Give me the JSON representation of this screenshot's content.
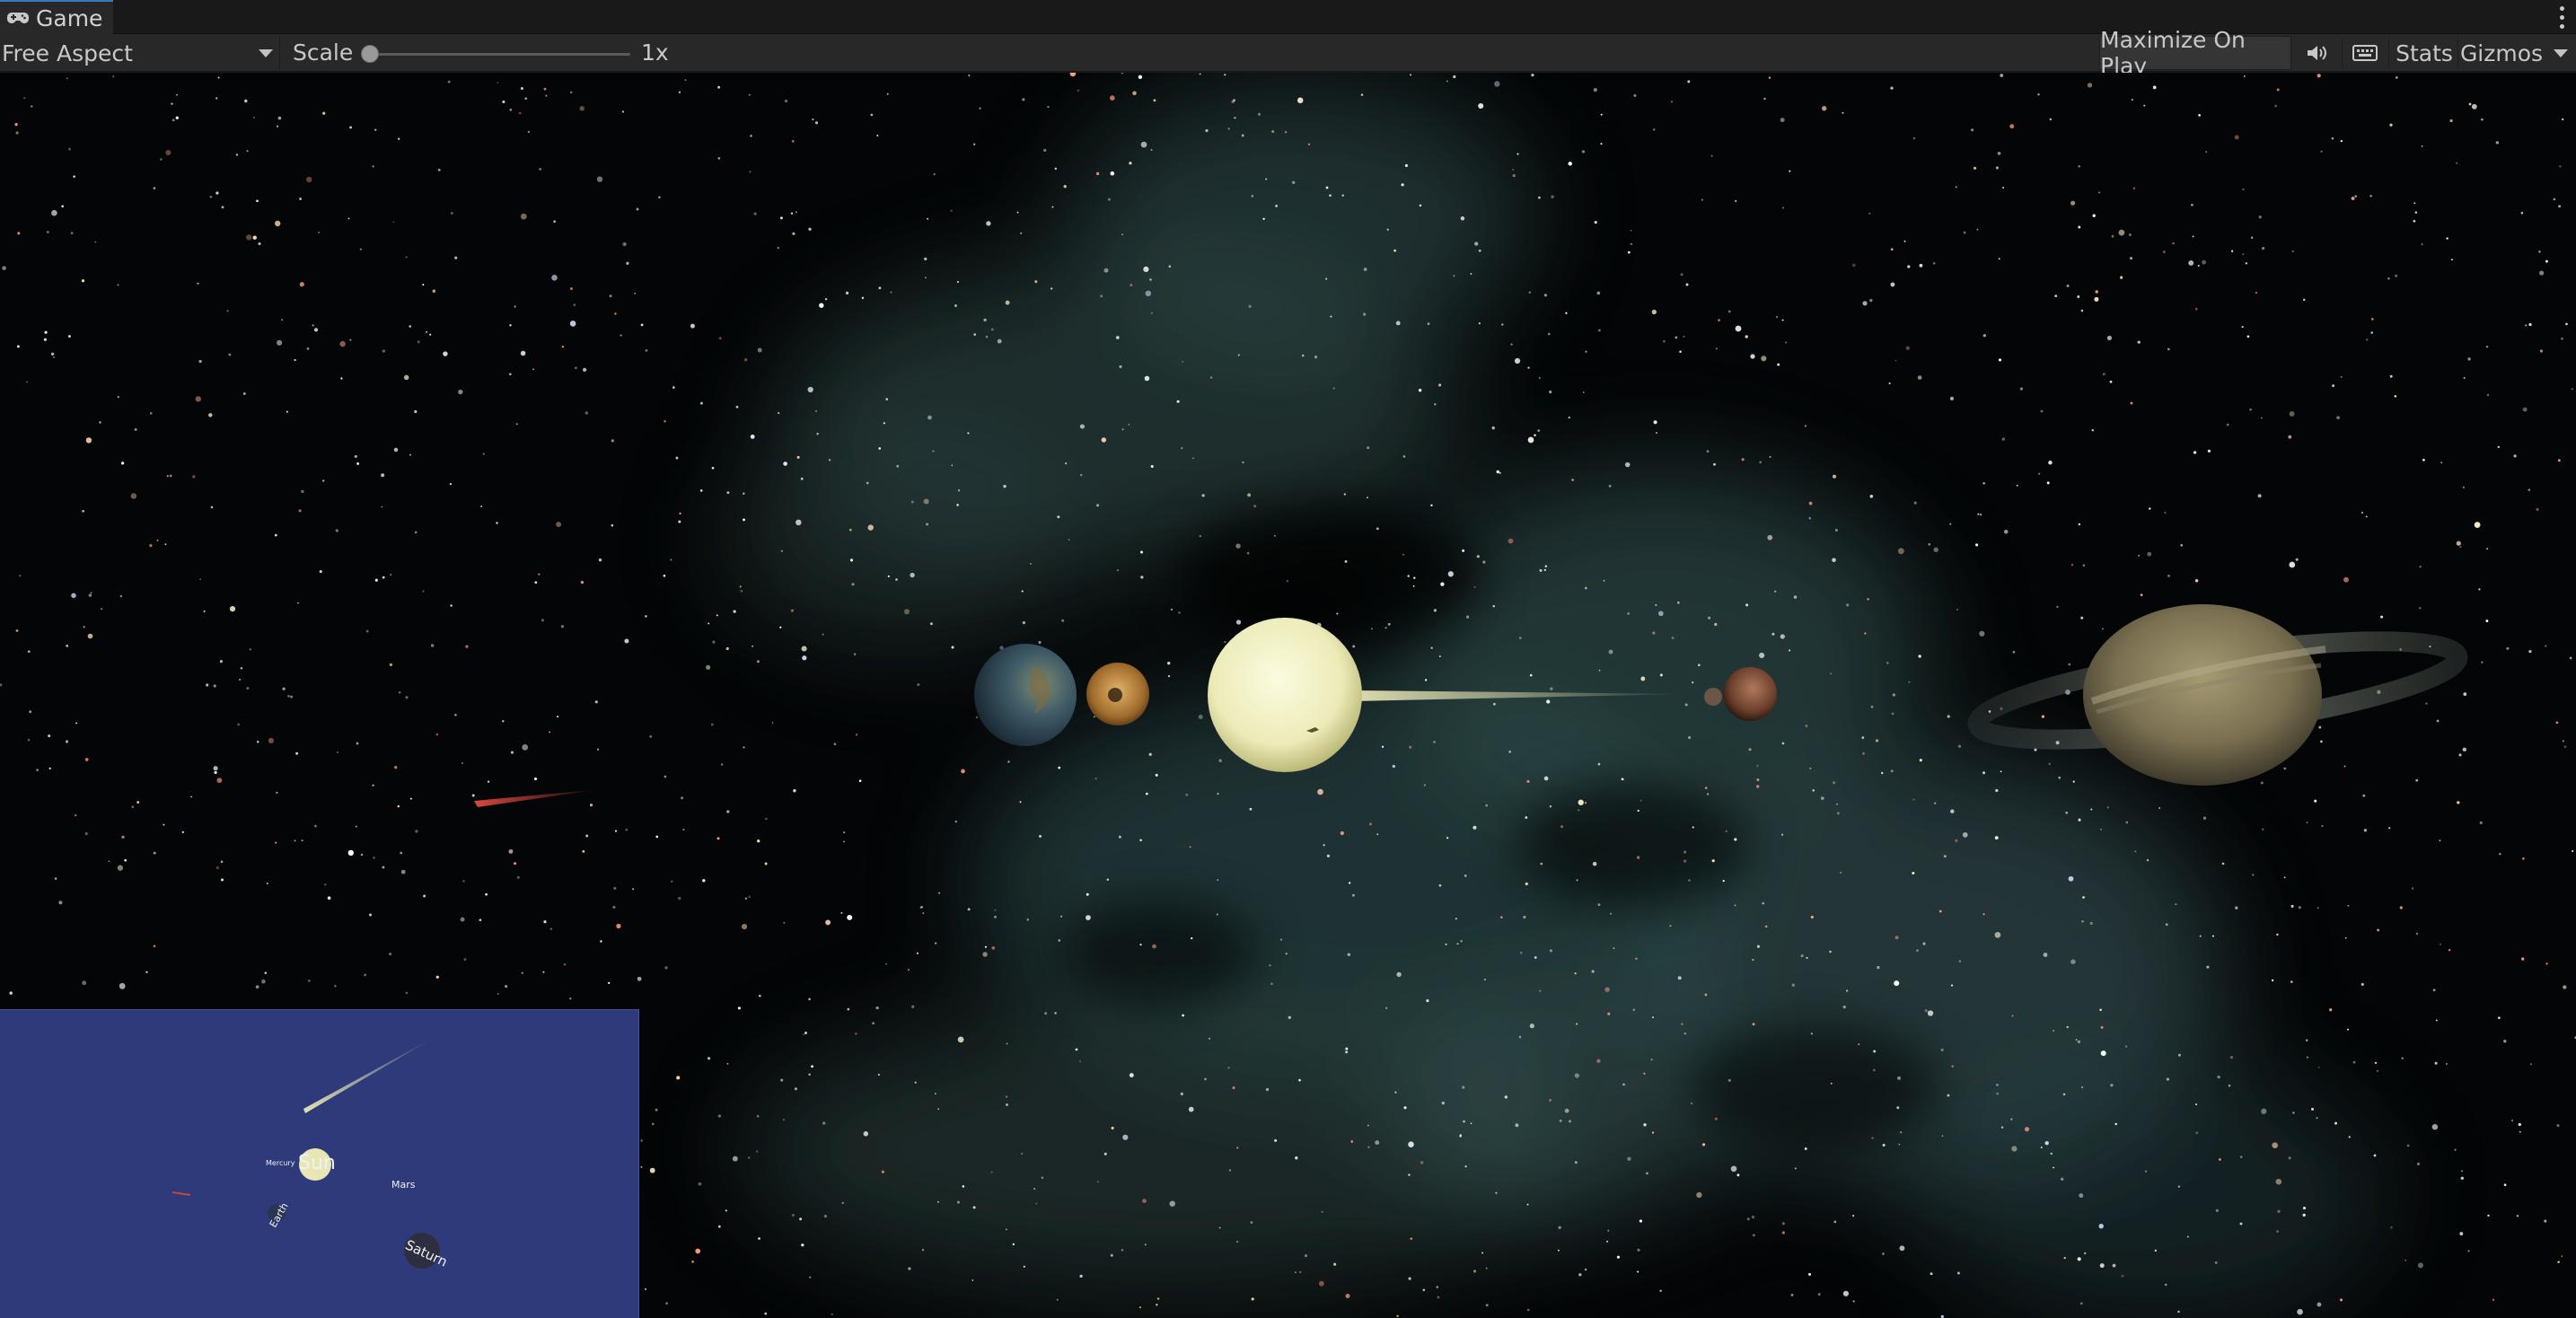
{
  "window": {
    "tab_title": "Game",
    "tab_icon": "gamepad-icon",
    "menu_icon": "kebab-menu-icon"
  },
  "toolbar": {
    "aspect_value": "Free Aspect",
    "scale_label": "Scale",
    "scale_value": "1x",
    "scale_slider_fraction": 0.0,
    "maximize_label": "Maximize On Play",
    "mute_icon": "speaker-icon",
    "keyboard_icon": "keyboard-icon",
    "stats_label": "Stats",
    "gizmos_label": "Gizmos"
  },
  "scene": {
    "background": "starfield with teal nebula",
    "objects": [
      "earth",
      "moon",
      "sun",
      "mercury",
      "mars",
      "saturn",
      "meteor"
    ]
  },
  "minimap": {
    "background_color": "#2e3a7a",
    "labels": {
      "sun": "Sun",
      "mars": "Mars",
      "saturn": "Saturn",
      "earth": "Earth",
      "small": "Mercury"
    }
  },
  "colors": {
    "editor_bg": "#282828",
    "editor_dark": "#191919",
    "tab_accent": "#3a79bb",
    "sun": "#f1f0c4",
    "meteor": "#d9483b"
  }
}
